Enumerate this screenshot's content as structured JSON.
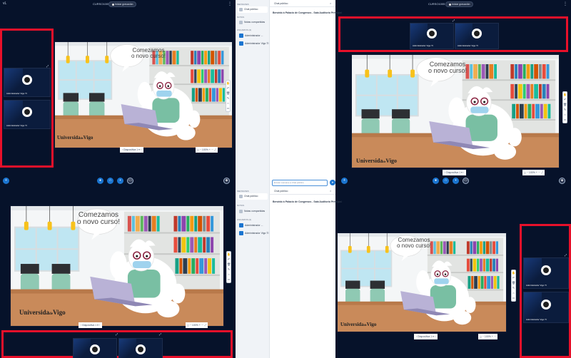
{
  "topbar": {
    "session_title": "CURSO1005",
    "record_label": "Iniciar gravación"
  },
  "slide": {
    "speech_text": "Comezamos o novo curso!",
    "speech_line1": "Comezamos",
    "speech_line2": "o novo curso!",
    "logo_text": "Universida",
    "logo_small": "de",
    "logo_end": "Vigo",
    "nav_label": "Diapositiva 1",
    "zoom_label": "100%"
  },
  "webcams": {
    "name_label": "Administrador Vigo TI"
  },
  "sidebar": {
    "messages_header": "MENSAXES",
    "public_chat": "Chat público",
    "notes_header": "NOTAS",
    "shared_notes": "Notas compartidas",
    "users_header": "USUARIOS (2)",
    "users": [
      {
        "name": "Administrador ..."
      },
      {
        "name": "Administrador Vigo TI"
      }
    ]
  },
  "chat": {
    "title": "Chat público",
    "welcome": "Benvido á Palacio de Congresos - Sala Auditorio Principal",
    "input_placeholder": "Enviar mensaxe a Chat público"
  },
  "colors": {
    "meeting_bg": "#06122a",
    "highlight_border": "#e8102a",
    "accent": "#1b75d0"
  }
}
